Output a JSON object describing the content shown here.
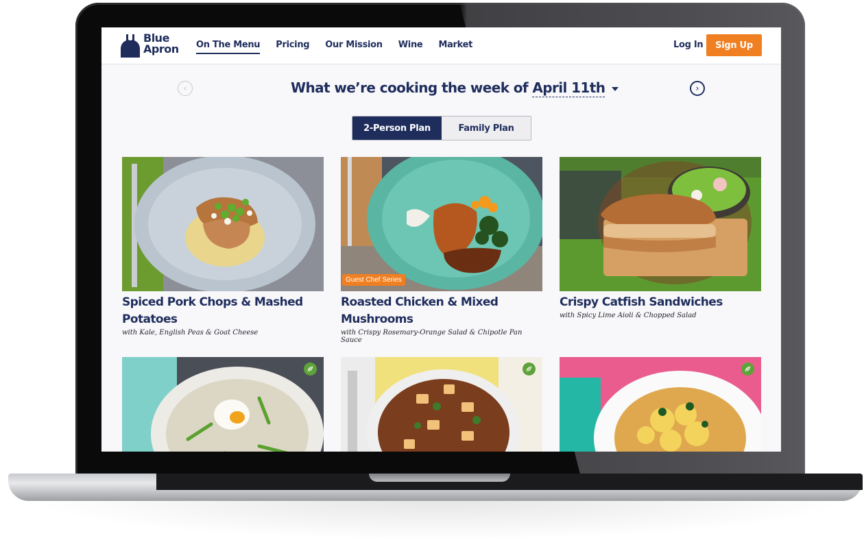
{
  "header": {
    "logo_line1": "Blue",
    "logo_line2": "Apron",
    "nav": [
      "On The Menu",
      "Pricing",
      "Our Mission",
      "Wine",
      "Market"
    ],
    "login_label": "Log In",
    "signup_label": "Sign Up"
  },
  "week": {
    "heading_prefix": "What we’re cooking the week of",
    "date": "April 11th"
  },
  "plans": {
    "two_person": "2-Person Plan",
    "family": "Family Plan",
    "selected": "2-Person Plan"
  },
  "recipes": [
    {
      "title": "Spiced Pork Chops & Mashed Potatoes",
      "subtitle": "with Kale, English Peas & Goat Cheese"
    },
    {
      "title": "Roasted Chicken & Mixed Mushrooms",
      "subtitle": "with Crispy Rosemary-Orange Salad & Chipotle Pan Sauce",
      "badge": "Guest Chef Series"
    },
    {
      "title": "Crispy Catfish Sandwiches",
      "subtitle": "with Spicy Lime Aioli & Chopped Salad"
    }
  ],
  "colors": {
    "brand_navy": "#1f2d5c",
    "accent_orange": "#f07f21",
    "vegetarian_green": "#5ea33a"
  },
  "icons": {
    "prev": "chevron-left-icon",
    "next": "chevron-right-icon",
    "vegetarian": "leaf-icon"
  }
}
